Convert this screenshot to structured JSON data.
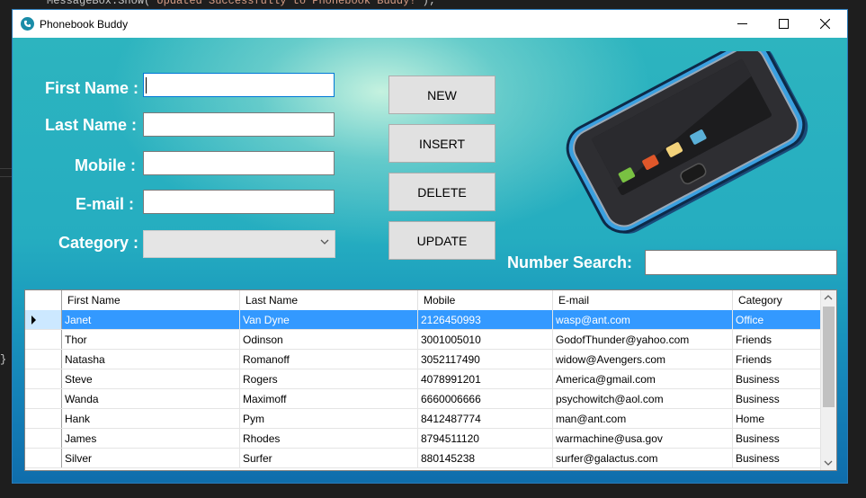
{
  "ide": {
    "code_prefix": "MessageBox.Show(",
    "code_string": "\"Updated Successfully to Phonebook Buddy!\"",
    "code_suffix": ");",
    "brace": "}"
  },
  "window": {
    "title": "Phonebook Buddy"
  },
  "form": {
    "first_name_label": "First Name :",
    "last_name_label": "Last Name :",
    "mobile_label": "Mobile :",
    "email_label": "E-mail :",
    "category_label": "Category :",
    "first_name_value": "",
    "last_name_value": "",
    "mobile_value": "",
    "email_value": "",
    "category_value": ""
  },
  "buttons": {
    "new": "NEW",
    "insert": "INSERT",
    "delete": "DELETE",
    "update": "UPDATE"
  },
  "search": {
    "label": "Number Search:",
    "value": ""
  },
  "grid": {
    "columns": [
      "First Name",
      "Last Name",
      "Mobile",
      "E-mail",
      "Category"
    ],
    "selected_row": 0,
    "rows": [
      [
        "Janet",
        "Van Dyne",
        "2126450993",
        "wasp@ant.com",
        "Office"
      ],
      [
        "Thor",
        "Odinson",
        "3001005010",
        "GodofThunder@yahoo.com",
        "Friends"
      ],
      [
        "Natasha",
        "Romanoff",
        "3052117490",
        "widow@Avengers.com",
        "Friends"
      ],
      [
        "Steve",
        "Rogers",
        "4078991201",
        "America@gmail.com",
        "Business"
      ],
      [
        "Wanda",
        "Maximoff",
        "6660006666",
        "psychowitch@aol.com",
        "Business"
      ],
      [
        "Hank",
        "Pym",
        "8412487774",
        "man@ant.com",
        "Home"
      ],
      [
        "James",
        "Rhodes",
        "8794511120",
        "warmachine@usa.gov",
        "Business"
      ],
      [
        "Silver",
        "Surfer",
        "880145238",
        "surfer@galactus.com",
        "Business"
      ]
    ]
  },
  "colors": {
    "selection": "#3399ff",
    "accent": "#1a8ca8"
  },
  "icons": {
    "app": "phone-icon",
    "minimize": "minimize-icon",
    "maximize": "maximize-icon",
    "close": "close-icon",
    "dropdown": "chevron-down-icon",
    "illustration": "smartphone-icon"
  }
}
